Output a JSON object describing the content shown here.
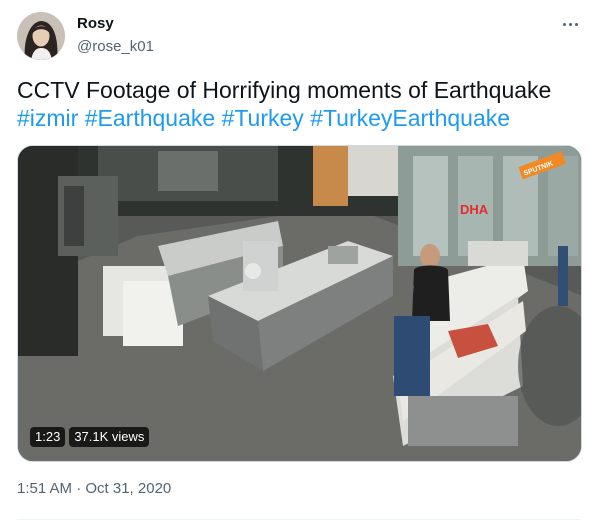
{
  "author": {
    "display_name": "Rosy",
    "handle": "@rose_k01"
  },
  "tweet": {
    "text": "CCTV Footage of Horrifying moments of Earthquake",
    "hashtags": [
      "#izmir",
      "#Earthquake",
      "#Turkey",
      "#TurkeyEarthquake"
    ],
    "timestamp": "1:51 AM · Oct 31, 2020"
  },
  "video": {
    "duration": "1:23",
    "views": "37.1K views",
    "watermark_brand": "DHA",
    "watermark_brand2": "SPUTNIK"
  },
  "colors": {
    "link": "#1d9bf0",
    "text": "#0f1419",
    "secondary": "#536471"
  },
  "icons": {
    "more": "more-horizontal-icon"
  }
}
